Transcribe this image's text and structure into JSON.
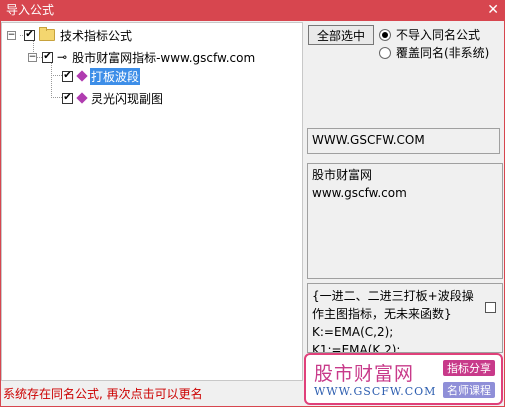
{
  "window": {
    "title": "导入公式",
    "close_glyph": "✕"
  },
  "tree": {
    "root": {
      "label": "技术指标公式",
      "checked": true,
      "icon": "folder-icon"
    },
    "group": {
      "label": "股市财富网指标-www.gscfw.com",
      "checked": true,
      "icon": "key-icon"
    },
    "items": [
      {
        "label": "打板波段",
        "checked": true,
        "selected": true
      },
      {
        "label": "灵光闪现副图",
        "checked": true,
        "selected": false
      }
    ]
  },
  "toolbar": {
    "select_all_label": "全部选中"
  },
  "options": {
    "no_import_label": "不导入同名公式",
    "overwrite_label": "覆盖同名(非系统)",
    "selected": "no_import"
  },
  "info": {
    "url_text": "WWW.GSCFW.COM",
    "desc_line1": "股市财富网",
    "desc_line2": "www.gscfw.com"
  },
  "formula": {
    "line1": "{一进二、二进三打板+波段操",
    "line2": "作主图指标，无未来函数}",
    "line3": "K:=EMA(C,2);",
    "line4": "K1:=EMA(K,2);"
  },
  "status": {
    "text": "系统存在同名公式, 再次点击可以更名"
  },
  "watermark": {
    "title": "股市财富网",
    "url": "WWW.GSCFW.COM",
    "tag1": "指标分享",
    "tag2": "名师课程"
  },
  "colors": {
    "accent": "#d7464f",
    "selection": "#3d8ee8",
    "status": "#cc0000"
  }
}
